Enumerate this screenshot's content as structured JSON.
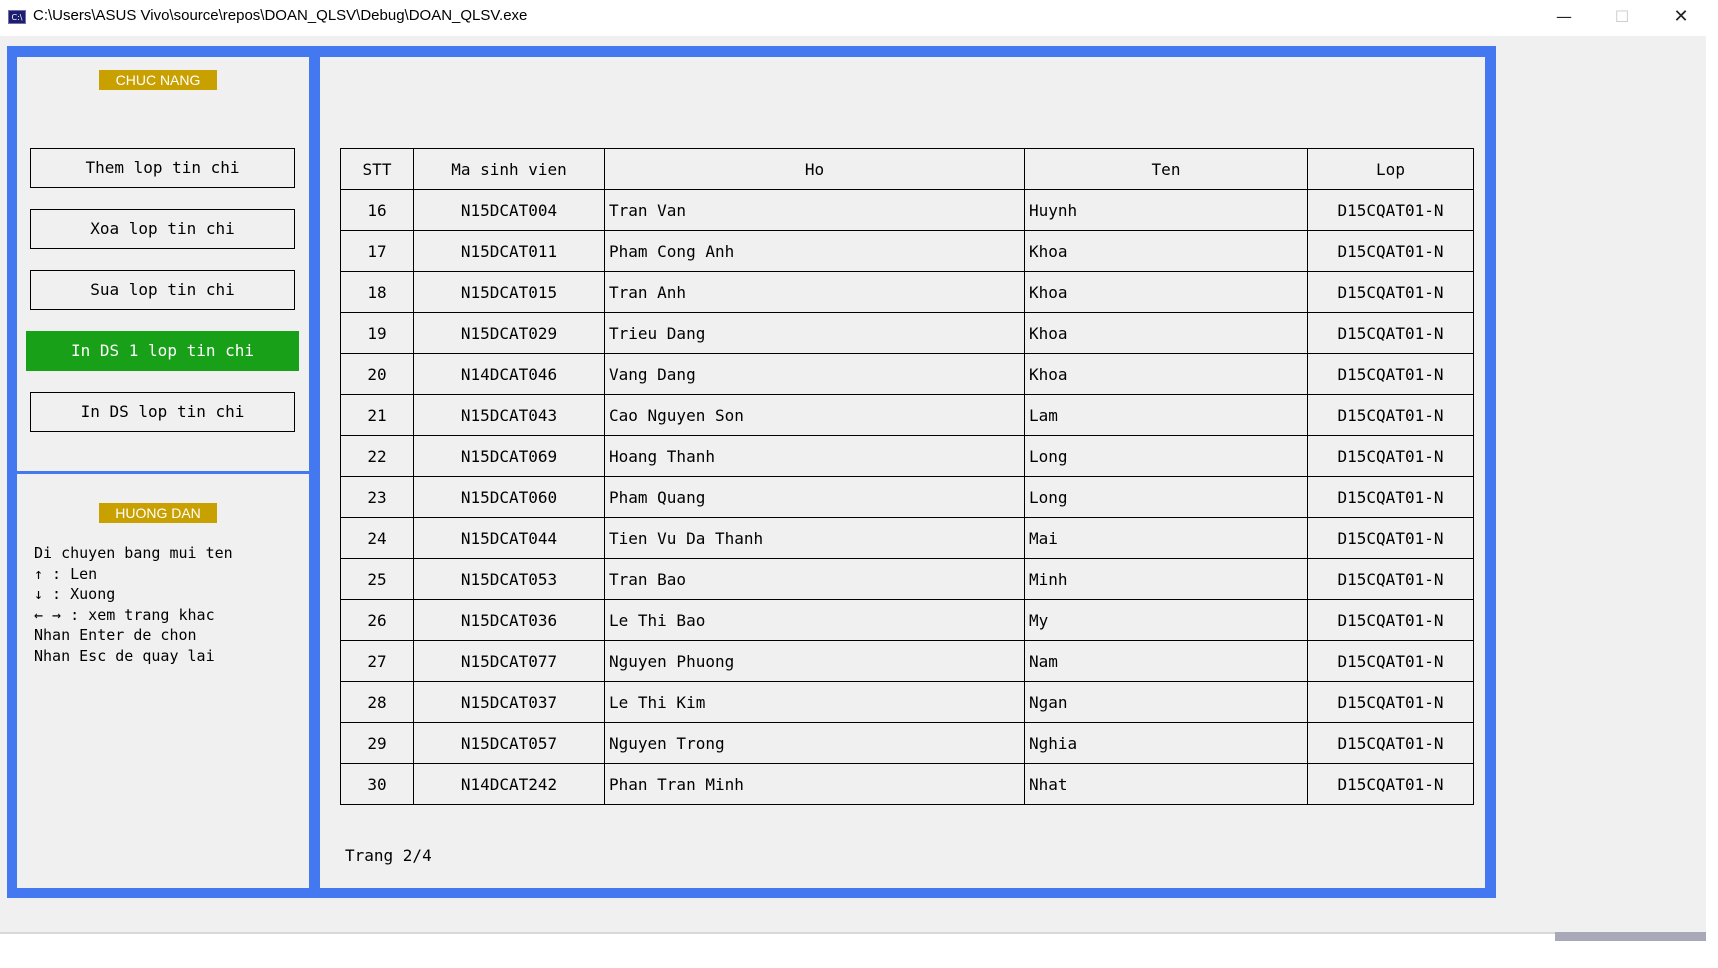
{
  "window": {
    "icon_text": "C:\\",
    "title": "C:\\Users\\ASUS Vivo\\source\\repos\\DOAN_QLSV\\Debug\\DOAN_QLSV.exe",
    "minimize": "—",
    "maximize": "☐",
    "close": "✕"
  },
  "sidebar": {
    "functions_label": "CHUC NANG",
    "menu": [
      {
        "label": "Them lop tin chi",
        "active": false
      },
      {
        "label": "Xoa lop tin chi",
        "active": false
      },
      {
        "label": "Sua lop tin chi",
        "active": false
      },
      {
        "label": "In DS 1 lop tin chi",
        "active": true
      },
      {
        "label": "In DS lop tin chi",
        "active": false
      }
    ],
    "guide_label": "HUONG DAN",
    "guide_lines": [
      "Di chuyen bang mui ten",
      "↑ : Len",
      "↓ : Xuong",
      "← → : xem trang khac",
      "Nhan Enter de chon",
      "Nhan Esc de quay lai"
    ],
    "active_color": "#18a018",
    "label_color": "#c8a000"
  },
  "table": {
    "headers": {
      "stt": "STT",
      "ma": "Ma sinh vien",
      "ho": "Ho",
      "ten": "Ten",
      "lop": "Lop"
    },
    "rows": [
      {
        "stt": "16",
        "ma": "N15DCAT004",
        "ho": "Tran Van",
        "ten": "Huynh",
        "lop": "D15CQAT01-N"
      },
      {
        "stt": "17",
        "ma": "N15DCAT011",
        "ho": "Pham Cong Anh",
        "ten": "Khoa",
        "lop": "D15CQAT01-N"
      },
      {
        "stt": "18",
        "ma": "N15DCAT015",
        "ho": "Tran Anh",
        "ten": "Khoa",
        "lop": "D15CQAT01-N"
      },
      {
        "stt": "19",
        "ma": "N15DCAT029",
        "ho": "Trieu Dang",
        "ten": "Khoa",
        "lop": "D15CQAT01-N"
      },
      {
        "stt": "20",
        "ma": "N14DCAT046",
        "ho": "Vang Dang",
        "ten": "Khoa",
        "lop": "D15CQAT01-N"
      },
      {
        "stt": "21",
        "ma": "N15DCAT043",
        "ho": "Cao Nguyen Son",
        "ten": "Lam",
        "lop": "D15CQAT01-N"
      },
      {
        "stt": "22",
        "ma": "N15DCAT069",
        "ho": "Hoang Thanh",
        "ten": "Long",
        "lop": "D15CQAT01-N"
      },
      {
        "stt": "23",
        "ma": "N15DCAT060",
        "ho": "Pham Quang",
        "ten": "Long",
        "lop": "D15CQAT01-N"
      },
      {
        "stt": "24",
        "ma": "N15DCAT044",
        "ho": "Tien Vu Da Thanh",
        "ten": "Mai",
        "lop": "D15CQAT01-N"
      },
      {
        "stt": "25",
        "ma": "N15DCAT053",
        "ho": "Tran Bao",
        "ten": "Minh",
        "lop": "D15CQAT01-N"
      },
      {
        "stt": "26",
        "ma": "N15DCAT036",
        "ho": "Le Thi Bao",
        "ten": "My",
        "lop": "D15CQAT01-N"
      },
      {
        "stt": "27",
        "ma": "N15DCAT077",
        "ho": "Nguyen Phuong",
        "ten": "Nam",
        "lop": "D15CQAT01-N"
      },
      {
        "stt": "28",
        "ma": "N15DCAT037",
        "ho": "Le Thi Kim",
        "ten": "Ngan",
        "lop": "D15CQAT01-N"
      },
      {
        "stt": "29",
        "ma": "N15DCAT057",
        "ho": "Nguyen Trong",
        "ten": "Nghia",
        "lop": "D15CQAT01-N"
      },
      {
        "stt": "30",
        "ma": "N14DCAT242",
        "ho": "Phan Tran Minh",
        "ten": "Nhat",
        "lop": "D15CQAT01-N"
      }
    ]
  },
  "pagination": {
    "text": "Trang 2/4"
  },
  "theme": {
    "frame_color": "#4478f0",
    "panel_bg": "#f0f0f0"
  }
}
